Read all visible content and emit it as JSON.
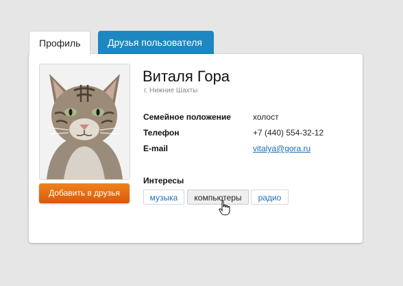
{
  "tabs": [
    {
      "label": "Профиль",
      "active": true
    },
    {
      "label": "Друзья пользователя",
      "active": false
    }
  ],
  "profile": {
    "name": "Виталя Гора",
    "city": "г. Нижние Шахты",
    "add_button": "Добавить в друзья",
    "fields": [
      {
        "label": "Семейное положение",
        "value": "холост"
      },
      {
        "label": "Телефон",
        "value": "+7 (440) 554-32-12"
      },
      {
        "label": "E-mail",
        "value": "vitalya@gora.ru"
      }
    ],
    "interests_title": "Интересы",
    "interests": [
      "музыка",
      "компьютеры",
      "радио"
    ]
  },
  "colors": {
    "accent_blue": "#1d87c1",
    "button_orange": "#e8700f",
    "link": "#1d6fb0"
  },
  "icons": {
    "cursor": "hand-pointer-icon"
  }
}
